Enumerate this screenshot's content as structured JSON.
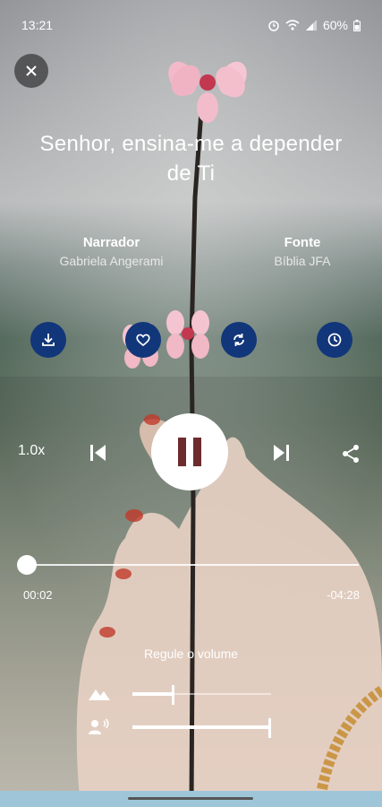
{
  "status_bar": {
    "time": "13:21",
    "battery": "60%"
  },
  "title": "Senhor, ensina-me a depender de Ti",
  "narrator": {
    "label": "Narrador",
    "value": "Gabriela Angerami"
  },
  "source": {
    "label": "Fonte",
    "value": "Bíblia JFA"
  },
  "actions": [
    {
      "icon": "download-icon"
    },
    {
      "icon": "heart-icon"
    },
    {
      "icon": "repeat-icon"
    },
    {
      "icon": "clock-icon"
    }
  ],
  "player": {
    "speed": "1.0x",
    "elapsed": "00:02",
    "remaining": "-04:28",
    "progress_fraction": 0.008
  },
  "volume": {
    "label": "Regule o volume",
    "ambient_level": 0.3,
    "voice_level": 1.0
  },
  "colors": {
    "action_button_bg": "#12367a",
    "nav_bar": "#9ec6d8"
  }
}
